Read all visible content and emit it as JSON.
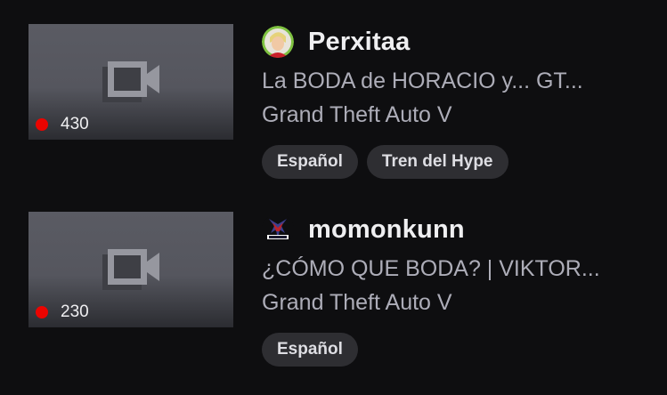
{
  "streams": [
    {
      "viewers": "430",
      "channel": "Perxitaa",
      "title": "La BODA de HORACIO y... GT...",
      "category": "Grand Theft Auto V",
      "tags": [
        "Español",
        "Tren del Hype"
      ]
    },
    {
      "viewers": "230",
      "channel": "momonkunn",
      "title": "¿CÓMO QUE BODA? | VIKTOR...",
      "category": "Grand Theft Auto V",
      "tags": [
        "Español"
      ]
    }
  ],
  "colors": {
    "background": "#0e0e10",
    "live_dot": "#eb0400",
    "tag_bg": "#2e2e32",
    "primary_text": "#efeff1",
    "secondary_text": "#adadb8"
  },
  "icons": {
    "thumbnail_placeholder": "video-camera-icon",
    "live_indicator": "live-dot-icon"
  }
}
